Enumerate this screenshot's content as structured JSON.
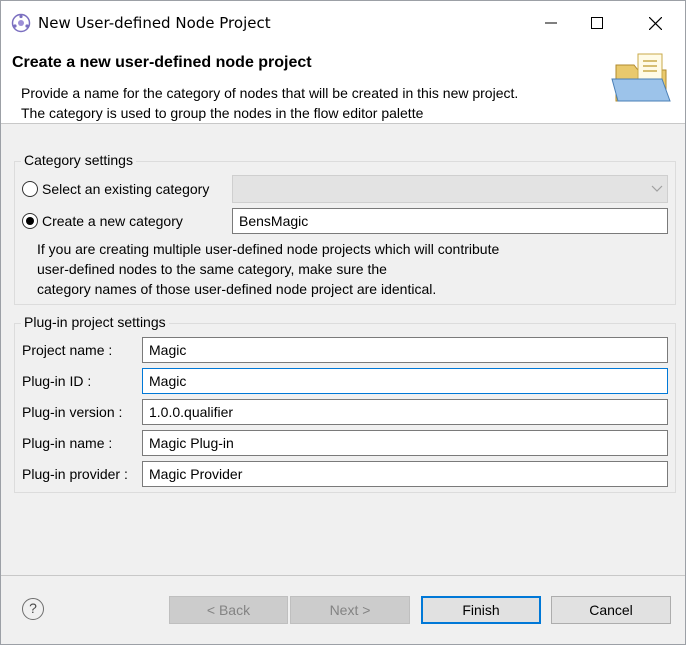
{
  "window": {
    "title": "New User-defined Node Project"
  },
  "banner": {
    "title": "Create a new user-defined node project",
    "description_line1": "Provide a name for the category of nodes that will be created in this new project.",
    "description_line2": "The category is used to group the nodes in the flow editor palette"
  },
  "category_settings": {
    "group_label": "Category settings",
    "existing_label": "Select an existing category",
    "new_label": "Create a new category",
    "new_value": "BensMagic",
    "selected_option": "Create a new category",
    "info_line1": "If you are creating multiple user-defined node projects which will contribute",
    "info_line2": "user-defined nodes to the same category, make sure the",
    "info_line3": "category names of those user-defined node project are identical."
  },
  "plugin_settings": {
    "group_label": "Plug-in project settings",
    "fields": [
      {
        "label": "Project name :",
        "value": "Magic"
      },
      {
        "label": "Plug-in ID :",
        "value": "Magic"
      },
      {
        "label": "Plug-in version :",
        "value": "1.0.0.qualifier"
      },
      {
        "label": "Plug-in name :",
        "value": "Magic Plug-in"
      },
      {
        "label": "Plug-in provider :",
        "value": "Magic Provider"
      }
    ]
  },
  "buttons": {
    "help_symbol": "?",
    "back": "< Back",
    "next": "Next >",
    "finish": "Finish",
    "cancel": "Cancel"
  },
  "colors": {
    "accent": "#0078d7",
    "dialog_background": "#f0f0f0"
  },
  "icons": {
    "app": "eclipse-app-icon",
    "banner": "folder-document-icon",
    "help": "help-icon"
  }
}
